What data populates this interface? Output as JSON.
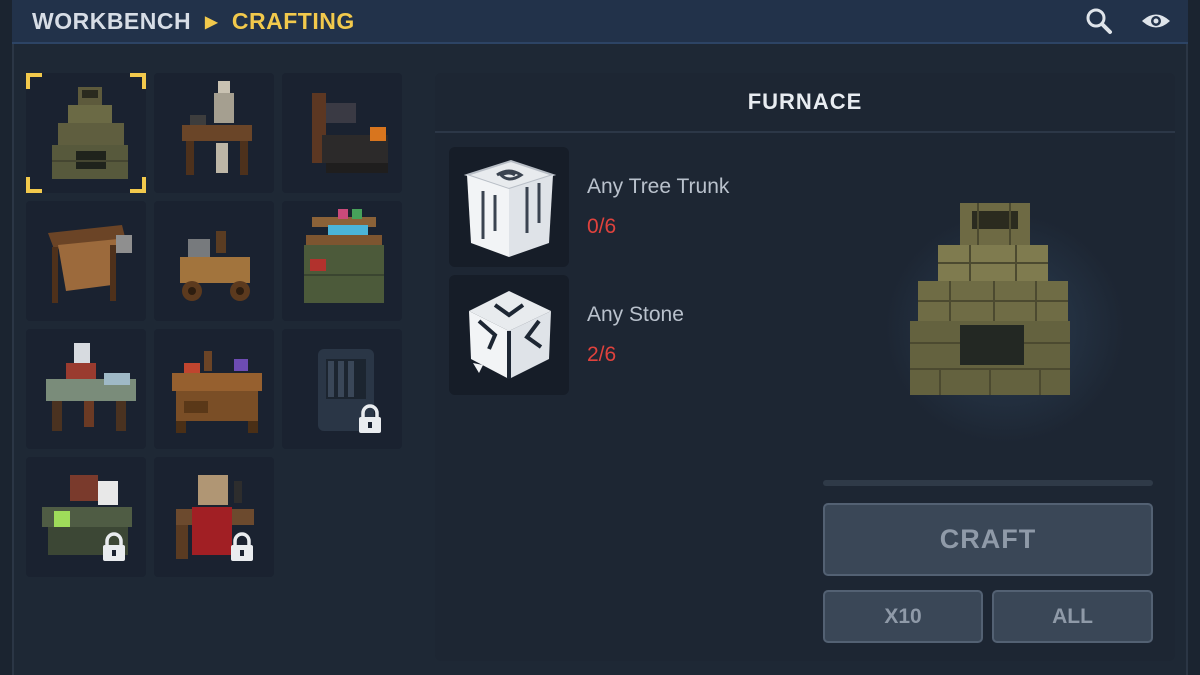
{
  "header": {
    "breadcrumb": [
      "WORKBENCH",
      "CRAFTING"
    ],
    "icons": [
      "search-icon",
      "eye-icon"
    ]
  },
  "recipes": [
    {
      "name": "furnace",
      "selected": true,
      "locked": false
    },
    {
      "name": "skeleton-workbench",
      "selected": false,
      "locked": false
    },
    {
      "name": "forge",
      "selected": false,
      "locked": false
    },
    {
      "name": "tanning-rack",
      "selected": false,
      "locked": false
    },
    {
      "name": "cart-bench",
      "selected": false,
      "locked": false
    },
    {
      "name": "alchemy-shelf",
      "selected": false,
      "locked": false
    },
    {
      "name": "tailoring-table",
      "selected": false,
      "locked": false
    },
    {
      "name": "cooking-table",
      "selected": false,
      "locked": false
    },
    {
      "name": "dark-cabinet",
      "selected": false,
      "locked": true
    },
    {
      "name": "potion-table",
      "selected": false,
      "locked": true
    },
    {
      "name": "banner-table",
      "selected": false,
      "locked": true
    }
  ],
  "detail": {
    "title": "FURNACE",
    "ingredients": [
      {
        "name": "Any Tree Trunk",
        "count": "0/6",
        "icon": "tree-trunk-icon"
      },
      {
        "name": "Any Stone",
        "count": "2/6",
        "icon": "stone-icon"
      }
    ],
    "progress": 0,
    "buttons": {
      "craft": "CRAFT",
      "x10": "X10",
      "all": "ALL"
    }
  },
  "colors": {
    "accent": "#f2c94c",
    "missing": "#e0423d",
    "header": "#22324a",
    "panel": "#1d2633"
  }
}
